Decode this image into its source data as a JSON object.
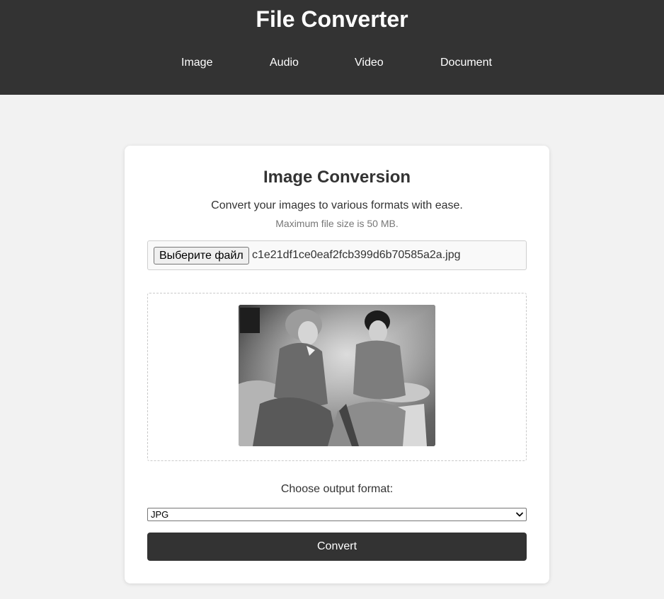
{
  "header": {
    "title": "File Converter",
    "nav": [
      {
        "label": "Image"
      },
      {
        "label": "Audio"
      },
      {
        "label": "Video"
      },
      {
        "label": "Document"
      }
    ]
  },
  "card": {
    "title": "Image Conversion",
    "description": "Convert your images to various formats with ease.",
    "note": "Maximum file size is 50 MB.",
    "file_input": {
      "button_label": "Выберите файл",
      "file_name": "c1e21df1ce0eaf2fcb399d6b70585a2a.jpg"
    },
    "preview": {
      "image_content": "black-and-white-photo-two-women"
    },
    "format_label": "Choose output format:",
    "format_select": {
      "selected": "JPG"
    },
    "convert_label": "Convert"
  },
  "colors": {
    "header_bg": "#333333",
    "page_bg": "#f2f2f2",
    "card_bg": "#ffffff",
    "button_bg": "#333333",
    "button_text": "#ffffff"
  },
  "icons": {
    "select_arrow": "chevron-down-icon"
  }
}
